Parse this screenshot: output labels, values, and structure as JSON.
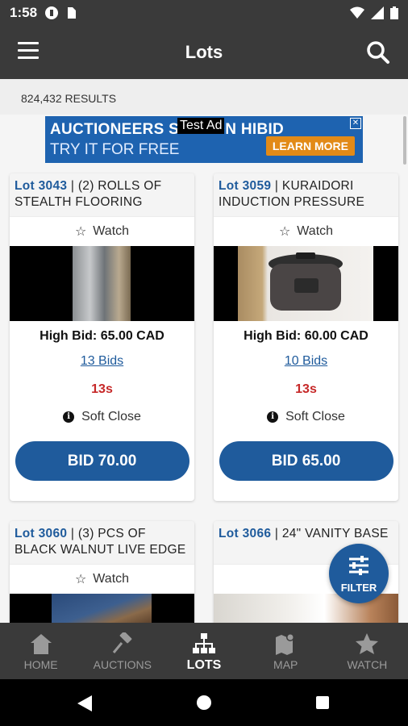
{
  "status_bar": {
    "time": "1:58"
  },
  "app_bar": {
    "title": "Lots"
  },
  "results": {
    "count_text": "824,432 RESULTS"
  },
  "ad": {
    "line1": "AUCTIONEERS SELL ON HIBID",
    "line2": "TRY IT FOR FREE",
    "label": "Test Ad",
    "cta": "LEARN MORE"
  },
  "lots": [
    {
      "lot_number": "Lot 3043",
      "title": " | (2) ROLLS OF STEALTH FLOORING",
      "watch_label": "Watch",
      "high_bid": "High Bid: 65.00 CAD",
      "bids": "13 Bids",
      "time_left": "13s",
      "close_type": "Soft Close",
      "bid_button": "BID 70.00"
    },
    {
      "lot_number": "Lot 3059",
      "title": " | KURAIDORI INDUCTION PRESSURE",
      "watch_label": "Watch",
      "high_bid": "High Bid: 60.00 CAD",
      "bids": "10 Bids",
      "time_left": "13s",
      "close_type": "Soft Close",
      "bid_button": "BID 65.00"
    },
    {
      "lot_number": "Lot 3060",
      "title": " | (3) PCS OF BLACK WALNUT LIVE EDGE",
      "watch_label": "Watch"
    },
    {
      "lot_number": "Lot 3066",
      "title": " | 24\" VANITY BASE"
    }
  ],
  "fab": {
    "label": "FILTER"
  },
  "bottom_nav": [
    {
      "label": "HOME",
      "icon": "home-icon"
    },
    {
      "label": "AUCTIONS",
      "icon": "gavel-icon"
    },
    {
      "label": "LOTS",
      "icon": "lots-hierarchy-icon",
      "active": true
    },
    {
      "label": "MAP",
      "icon": "map-pin-icon"
    },
    {
      "label": "WATCH",
      "icon": "star-icon"
    }
  ],
  "colors": {
    "bar": "#3a3a3a",
    "accent": "#1f5b9c",
    "time_left": "#c62828"
  }
}
